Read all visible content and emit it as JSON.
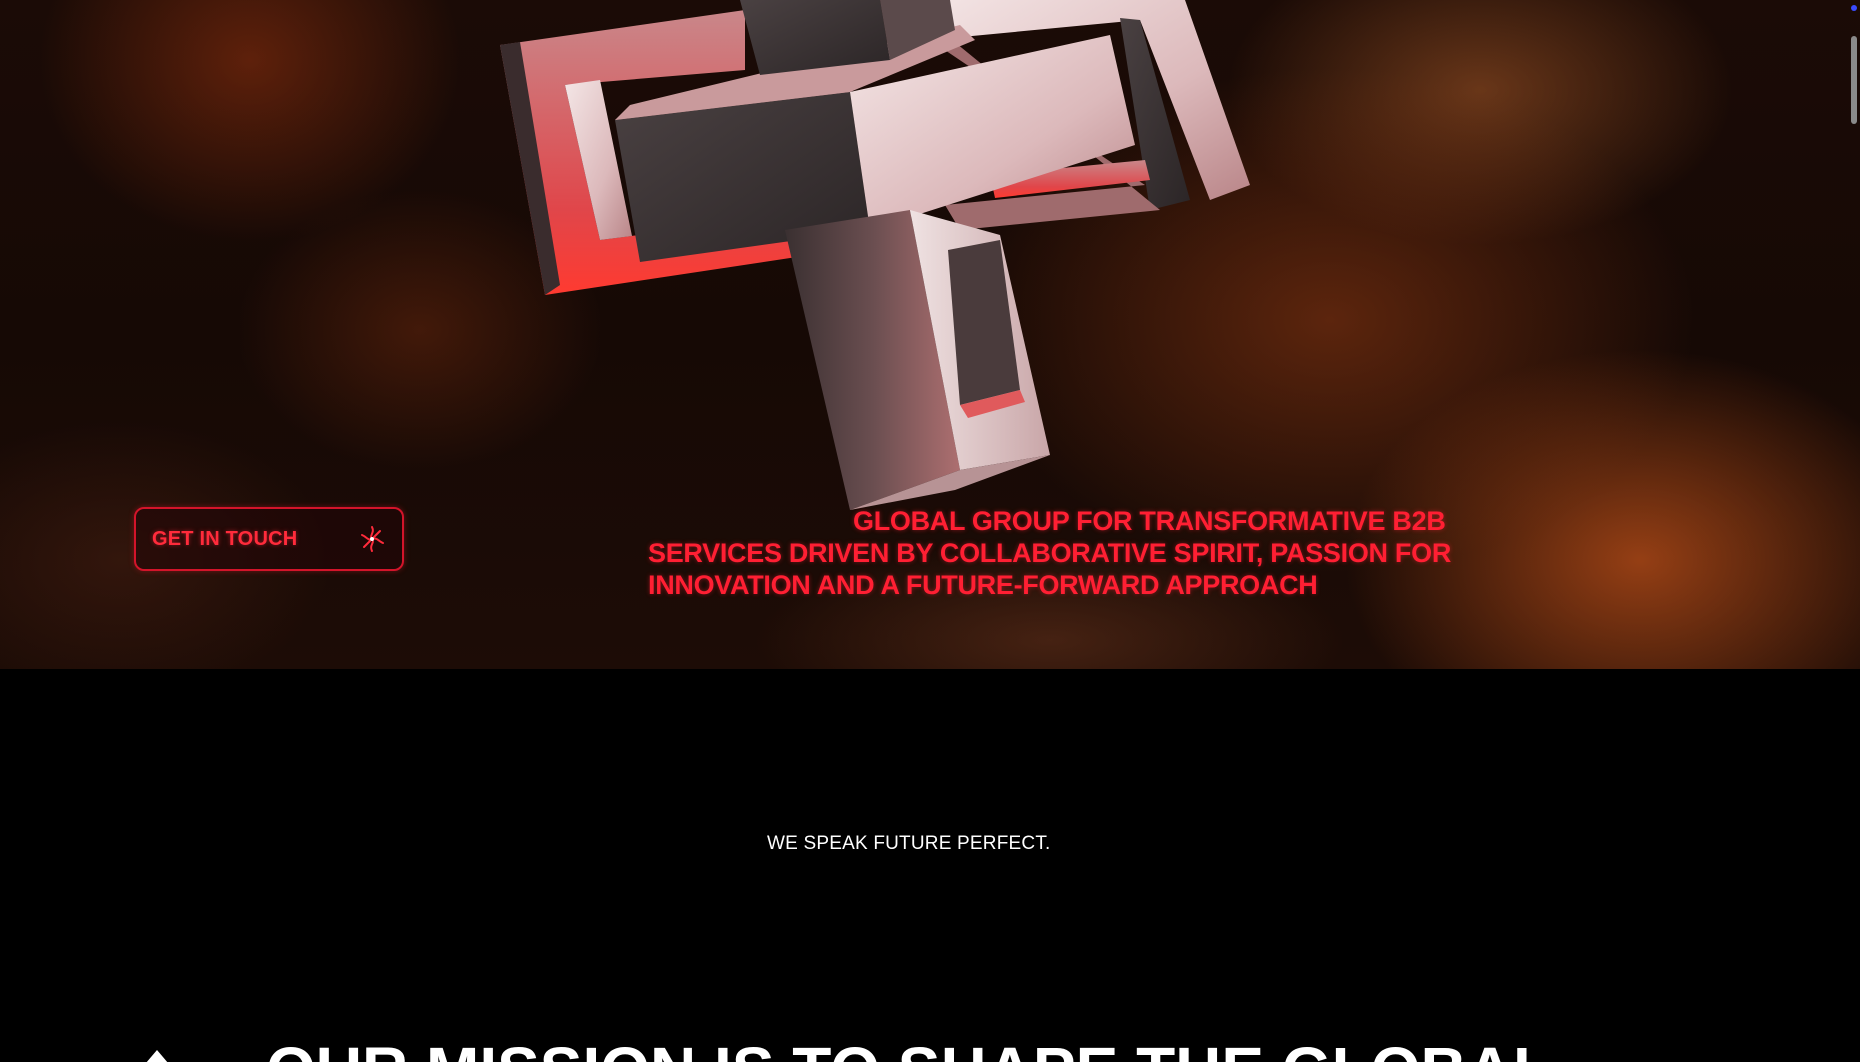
{
  "hero": {
    "cta": {
      "label": "GET IN TOUCH",
      "icon": "sparkle-burst-icon"
    },
    "statement": "GLOBAL GROUP FOR TRANSFORMATIVE B2B SERVICES DRIVEN BY COLLABORATIVE SPIRIT, PASSION FOR INNOVATION AND A FUTURE-FORWARD APPROACH"
  },
  "intro": {
    "tagline": "WE SPEAK FUTURE PERFECT.",
    "mission_heading": "OUR MISSION IS TO SHAPE THE GLOBAL",
    "mission_icon": "arrow-icon"
  },
  "colors": {
    "accent": "#ff1f33",
    "background": "#000000",
    "text": "#ffffff"
  }
}
